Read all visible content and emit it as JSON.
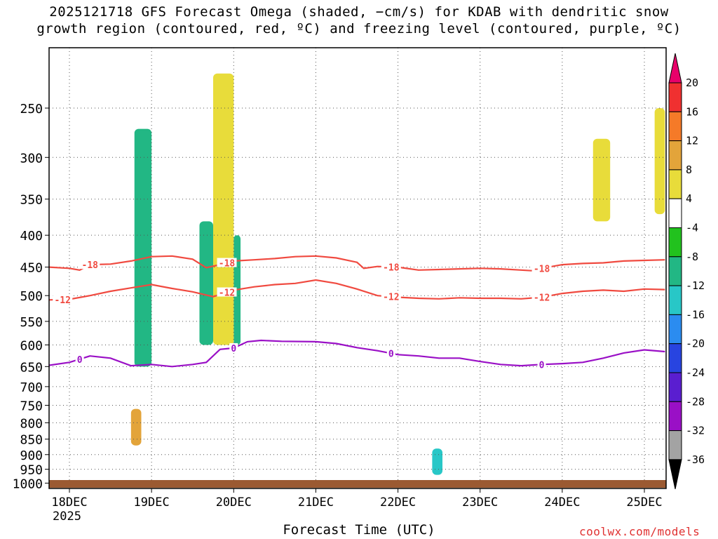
{
  "title_line1": "2025121718 GFS Forecast Omega (shaded, −cm/s) for KDAB with dendritic snow",
  "title_line2": "growth region (contoured, red, ºC) and freezing level (contoured, purple, ºC)",
  "credit": "coolwx.com/models",
  "chart_data": {
    "type": "heatmap",
    "xlabel": "Forecast Time (UTC)",
    "ylabel": "",
    "x_ticks": [
      "18DEC",
      "19DEC",
      "20DEC",
      "21DEC",
      "22DEC",
      "23DEC",
      "24DEC",
      "25DEC"
    ],
    "x_tick_sublabel": "2025",
    "x_range_hours": [
      0,
      174
    ],
    "y_ticks": [
      250,
      300,
      350,
      400,
      450,
      500,
      550,
      600,
      650,
      700,
      750,
      800,
      850,
      900,
      950,
      1000
    ],
    "y_range_hPa": [
      200,
      1020
    ],
    "y_scale": "log-pressure",
    "grid": true,
    "colorbar": {
      "labels": [
        "20",
        "16",
        "12",
        "8",
        "4",
        "-4",
        "-8",
        "-12",
        "-16",
        "-20",
        "-24",
        "-28",
        "-32",
        "-36"
      ],
      "colors": [
        "#e8006a",
        "#f03030",
        "#f57a28",
        "#e3a43a",
        "#e8dc3a",
        "#ffffff",
        "#22c21e",
        "#22b784",
        "#28c7c7",
        "#2b8cf0",
        "#2844e0",
        "#5a1ed0",
        "#9a10c6",
        "#a3a3a3",
        "#000000"
      ]
    },
    "contours": [
      {
        "name": "-18",
        "color": "#f04a40",
        "label_hours": [
          6,
          46,
          94,
          138
        ],
        "points": [
          [
            -6,
            450
          ],
          [
            0,
            452
          ],
          [
            3,
            455
          ],
          [
            6,
            446
          ],
          [
            12,
            445
          ],
          [
            18,
            440
          ],
          [
            24,
            433
          ],
          [
            30,
            432
          ],
          [
            36,
            437
          ],
          [
            40,
            451
          ],
          [
            44,
            446
          ],
          [
            48,
            440
          ],
          [
            54,
            438
          ],
          [
            60,
            436
          ],
          [
            66,
            433
          ],
          [
            72,
            432
          ],
          [
            78,
            435
          ],
          [
            84,
            442
          ],
          [
            86,
            452
          ],
          [
            90,
            449
          ],
          [
            96,
            450
          ],
          [
            102,
            455
          ],
          [
            108,
            454
          ],
          [
            114,
            453
          ],
          [
            120,
            452
          ],
          [
            126,
            453
          ],
          [
            132,
            455
          ],
          [
            135,
            456
          ],
          [
            138,
            452
          ],
          [
            144,
            446
          ],
          [
            150,
            444
          ],
          [
            156,
            443
          ],
          [
            162,
            440
          ],
          [
            168,
            439
          ],
          [
            174,
            438
          ]
        ]
      },
      {
        "name": "-12",
        "color": "#f04a40",
        "label_hours": [
          -2,
          46,
          94,
          138
        ],
        "points": [
          [
            -6,
            508
          ],
          [
            0,
            507
          ],
          [
            6,
            500
          ],
          [
            12,
            492
          ],
          [
            18,
            486
          ],
          [
            24,
            480
          ],
          [
            30,
            487
          ],
          [
            36,
            493
          ],
          [
            42,
            502
          ],
          [
            48,
            490
          ],
          [
            54,
            484
          ],
          [
            60,
            480
          ],
          [
            66,
            478
          ],
          [
            72,
            472
          ],
          [
            78,
            478
          ],
          [
            84,
            488
          ],
          [
            90,
            500
          ],
          [
            96,
            503
          ],
          [
            102,
            505
          ],
          [
            108,
            506
          ],
          [
            114,
            504
          ],
          [
            120,
            505
          ],
          [
            126,
            505
          ],
          [
            132,
            506
          ],
          [
            138,
            503
          ],
          [
            144,
            496
          ],
          [
            150,
            492
          ],
          [
            156,
            490
          ],
          [
            162,
            492
          ],
          [
            168,
            488
          ],
          [
            174,
            489
          ]
        ]
      },
      {
        "name": "0",
        "color": "#9a10c6",
        "label_hours": [
          3,
          48,
          94,
          138
        ],
        "points": [
          [
            -6,
            647
          ],
          [
            0,
            640
          ],
          [
            6,
            625
          ],
          [
            12,
            630
          ],
          [
            18,
            648
          ],
          [
            24,
            645
          ],
          [
            30,
            650
          ],
          [
            36,
            645
          ],
          [
            40,
            640
          ],
          [
            44,
            610
          ],
          [
            48,
            607
          ],
          [
            52,
            593
          ],
          [
            56,
            590
          ],
          [
            62,
            592
          ],
          [
            72,
            593
          ],
          [
            78,
            597
          ],
          [
            84,
            606
          ],
          [
            90,
            613
          ],
          [
            96,
            622
          ],
          [
            102,
            625
          ],
          [
            108,
            630
          ],
          [
            114,
            630
          ],
          [
            120,
            638
          ],
          [
            126,
            645
          ],
          [
            132,
            648
          ],
          [
            138,
            645
          ],
          [
            144,
            643
          ],
          [
            150,
            640
          ],
          [
            156,
            630
          ],
          [
            162,
            618
          ],
          [
            168,
            611
          ],
          [
            174,
            615
          ]
        ]
      }
    ],
    "omega_regions": [
      {
        "hour_range": [
          19,
          24
        ],
        "p_range": [
          270,
          650
        ],
        "value": -10
      },
      {
        "hour_range": [
          38,
          42
        ],
        "p_range": [
          380,
          600
        ],
        "value": -8
      },
      {
        "hour_range": [
          48,
          50
        ],
        "p_range": [
          400,
          600
        ],
        "value": -10
      },
      {
        "hour_range": [
          42,
          48
        ],
        "p_range": [
          220,
          600
        ],
        "value": 6
      },
      {
        "hour_range": [
          18,
          21
        ],
        "p_range": [
          760,
          870
        ],
        "value": 10
      },
      {
        "hour_range": [
          106,
          109
        ],
        "p_range": [
          880,
          970
        ],
        "value": -14
      },
      {
        "hour_range": [
          153,
          158
        ],
        "p_range": [
          280,
          380
        ],
        "value": 5
      },
      {
        "hour_range": [
          171,
          174
        ],
        "p_range": [
          250,
          370
        ],
        "value": 5
      }
    ]
  }
}
